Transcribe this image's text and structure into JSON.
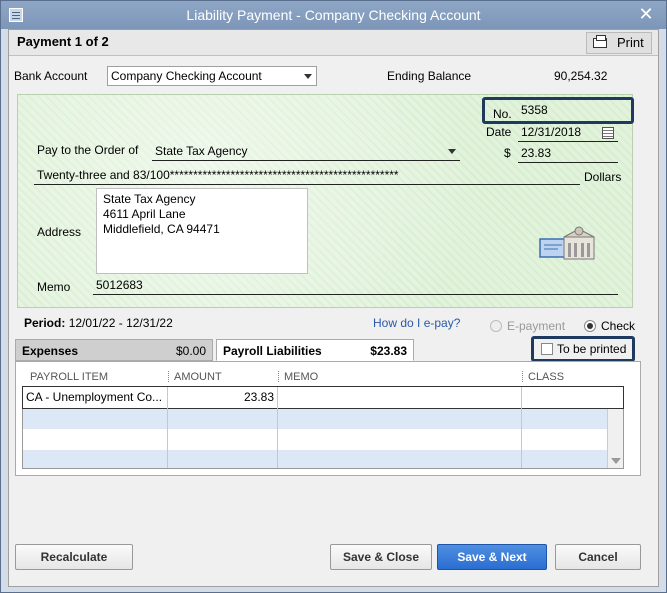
{
  "window": {
    "title": "Liability Payment - Company Checking Account"
  },
  "topbar": {
    "payment_label": "Payment 1 of 2",
    "print_label": "Print"
  },
  "account": {
    "bank_account_label": "Bank Account",
    "bank_account_value": "Company Checking Account",
    "ending_balance_label": "Ending Balance",
    "ending_balance_value": "90,254.32"
  },
  "check": {
    "no_label": "No.",
    "no_value": "5358",
    "date_label": "Date",
    "date_value": "12/31/2018",
    "pay_to_label": "Pay to the Order of",
    "payee": "State Tax Agency",
    "dollar_sign": "$",
    "amount": "23.83",
    "amount_words": "Twenty-three and 83/100*************************************************",
    "dollars_label": "Dollars",
    "address_label": "Address",
    "address_lines": [
      "State Tax Agency",
      "4611 April Lane",
      "Middlefield, CA 94471"
    ],
    "memo_label": "Memo",
    "memo_value": "5012683"
  },
  "period": {
    "label": "Period:",
    "value": "12/01/22 - 12/31/22"
  },
  "epay": {
    "link": "How do I e-pay?",
    "epayment_label": "E-payment",
    "check_label": "Check",
    "selected": "Check"
  },
  "to_be_printed": {
    "label": "To be printed",
    "checked": false
  },
  "tabs": [
    {
      "label": "Expenses",
      "amount": "$0.00",
      "active": false
    },
    {
      "label": "Payroll Liabilities",
      "amount": "$23.83",
      "active": true
    }
  ],
  "grid": {
    "columns": [
      "PAYROLL ITEM",
      "AMOUNT",
      "MEMO",
      "CLASS"
    ],
    "rows": [
      {
        "payroll_item": "CA - Unemployment Co...",
        "amount": "23.83",
        "memo": "",
        "class": ""
      }
    ]
  },
  "buttons": {
    "recalculate": "Recalculate",
    "save_close": "Save & Close",
    "save_next": "Save & Next",
    "cancel": "Cancel"
  },
  "colors": {
    "accent": "#2a6ed2",
    "highlight_border": "#1f3a5f",
    "check_bg": "#e2f3dc"
  }
}
